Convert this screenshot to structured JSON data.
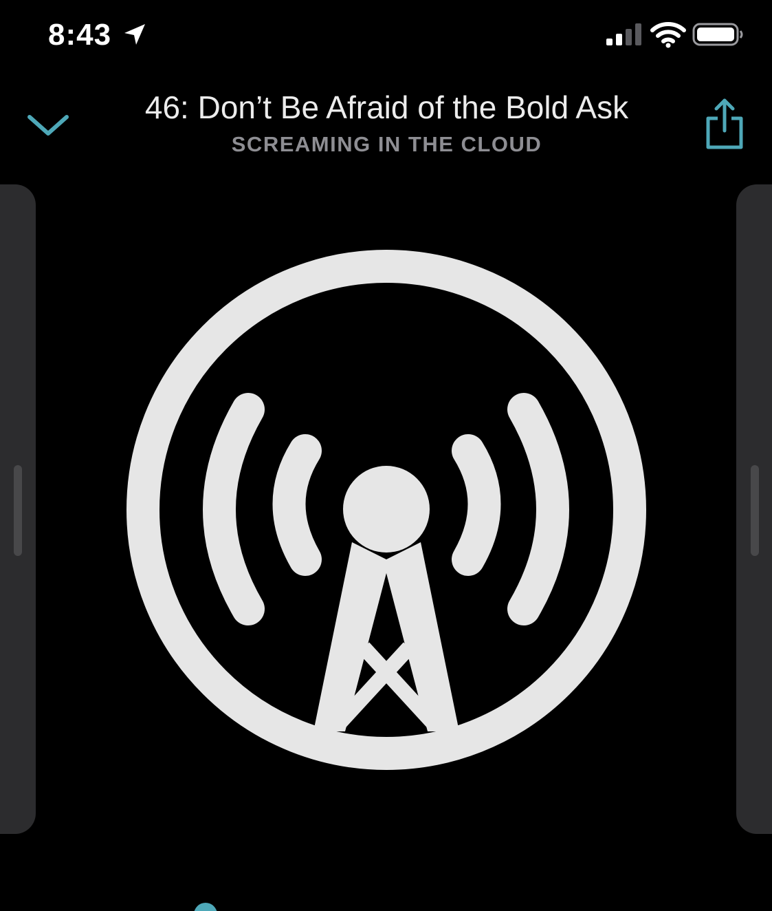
{
  "status_bar": {
    "time": "8:43",
    "location_icon": "location-arrow-icon",
    "signal_icon": "cellular-signal-icon",
    "wifi_icon": "wifi-icon",
    "battery_icon": "battery-icon"
  },
  "header": {
    "collapse_icon": "chevron-down-icon",
    "title": "46: Don’t Be Afraid of the Bold Ask",
    "podcast": "SCREAMING IN THE CLOUD",
    "share_icon": "share-icon"
  },
  "artwork": {
    "icon": "overcast-broadcast-tower-icon"
  },
  "colors": {
    "accent": "#4ea8b8",
    "background": "#000000",
    "panel": "#2c2c2e",
    "title_text": "#ececec",
    "subtitle_text": "#8e8e93",
    "artwork_fill": "#e6e6e6"
  }
}
